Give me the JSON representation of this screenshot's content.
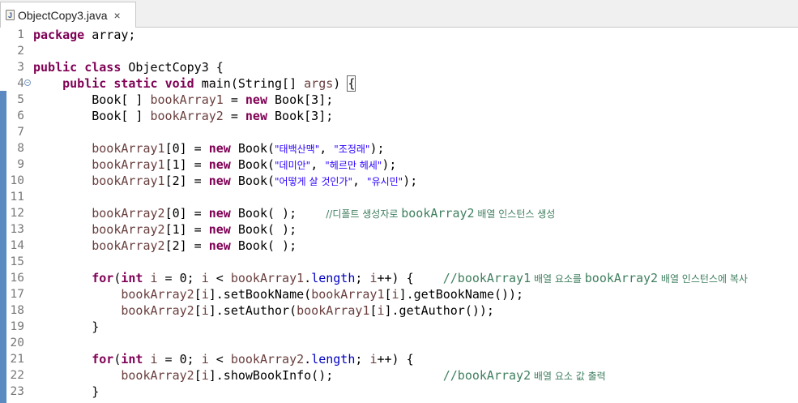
{
  "tab": {
    "title": "ObjectCopy3.java",
    "icon": "J",
    "close": "×"
  },
  "lines": [
    {
      "n": "1",
      "code": [
        {
          "t": "package",
          "c": "kw"
        },
        {
          "t": " array;"
        }
      ]
    },
    {
      "n": "2",
      "code": []
    },
    {
      "n": "3",
      "code": [
        {
          "t": "public",
          "c": "kw"
        },
        {
          "t": " "
        },
        {
          "t": "class",
          "c": "kw"
        },
        {
          "t": " ObjectCopy3 {"
        }
      ]
    },
    {
      "n": "4",
      "fold": true,
      "code": [
        {
          "t": "    "
        },
        {
          "t": "public",
          "c": "kw"
        },
        {
          "t": " "
        },
        {
          "t": "static",
          "c": "kw"
        },
        {
          "t": " "
        },
        {
          "t": "void",
          "c": "kw"
        },
        {
          "t": " main(String[] "
        },
        {
          "t": "args",
          "c": "var"
        },
        {
          "t": ") "
        },
        {
          "t": "{",
          "c": "brk"
        }
      ]
    },
    {
      "n": "5",
      "code": [
        {
          "t": "        Book[ ] "
        },
        {
          "t": "bookArray1",
          "c": "var"
        },
        {
          "t": " = "
        },
        {
          "t": "new",
          "c": "kw"
        },
        {
          "t": " Book[3];"
        }
      ]
    },
    {
      "n": "6",
      "code": [
        {
          "t": "        Book[ ] "
        },
        {
          "t": "bookArray2",
          "c": "var"
        },
        {
          "t": " = "
        },
        {
          "t": "new",
          "c": "kw"
        },
        {
          "t": " Book[3];"
        }
      ]
    },
    {
      "n": "7",
      "code": []
    },
    {
      "n": "8",
      "code": [
        {
          "t": "        "
        },
        {
          "t": "bookArray1",
          "c": "var"
        },
        {
          "t": "[0] = "
        },
        {
          "t": "new",
          "c": "kw"
        },
        {
          "t": " Book("
        },
        {
          "t": "\"태백산맥\"",
          "c": "str ko"
        },
        {
          "t": ", "
        },
        {
          "t": "\"조정래\"",
          "c": "str ko"
        },
        {
          "t": ");"
        }
      ]
    },
    {
      "n": "9",
      "code": [
        {
          "t": "        "
        },
        {
          "t": "bookArray1",
          "c": "var"
        },
        {
          "t": "[1] = "
        },
        {
          "t": "new",
          "c": "kw"
        },
        {
          "t": " Book("
        },
        {
          "t": "\"데미안\"",
          "c": "str ko"
        },
        {
          "t": ", "
        },
        {
          "t": "\"헤르만 헤세\"",
          "c": "str ko"
        },
        {
          "t": ");"
        }
      ]
    },
    {
      "n": "10",
      "code": [
        {
          "t": "        "
        },
        {
          "t": "bookArray1",
          "c": "var"
        },
        {
          "t": "[2] = "
        },
        {
          "t": "new",
          "c": "kw"
        },
        {
          "t": " Book("
        },
        {
          "t": "\"어떻게 살 것인가\"",
          "c": "str ko"
        },
        {
          "t": ", "
        },
        {
          "t": "\"유시민\"",
          "c": "str ko"
        },
        {
          "t": ");"
        }
      ]
    },
    {
      "n": "11",
      "code": []
    },
    {
      "n": "12",
      "code": [
        {
          "t": "        "
        },
        {
          "t": "bookArray2",
          "c": "var"
        },
        {
          "t": "[0] = "
        },
        {
          "t": "new",
          "c": "kw"
        },
        {
          "t": " Book( );    "
        },
        {
          "t": "//디폴트 생성자로 ",
          "c": "cmt ko"
        },
        {
          "t": "bookArray2",
          "c": "cmt"
        },
        {
          "t": " 배열 인스턴스 생성",
          "c": "cmt ko"
        }
      ]
    },
    {
      "n": "13",
      "code": [
        {
          "t": "        "
        },
        {
          "t": "bookArray2",
          "c": "var"
        },
        {
          "t": "[1] = "
        },
        {
          "t": "new",
          "c": "kw"
        },
        {
          "t": " Book( );"
        }
      ]
    },
    {
      "n": "14",
      "code": [
        {
          "t": "        "
        },
        {
          "t": "bookArray2",
          "c": "var"
        },
        {
          "t": "[2] = "
        },
        {
          "t": "new",
          "c": "kw"
        },
        {
          "t": " Book( );"
        }
      ]
    },
    {
      "n": "15",
      "code": []
    },
    {
      "n": "16",
      "code": [
        {
          "t": "        "
        },
        {
          "t": "for",
          "c": "kw"
        },
        {
          "t": "("
        },
        {
          "t": "int",
          "c": "kw"
        },
        {
          "t": " "
        },
        {
          "t": "i",
          "c": "var"
        },
        {
          "t": " = 0; "
        },
        {
          "t": "i",
          "c": "var"
        },
        {
          "t": " < "
        },
        {
          "t": "bookArray1",
          "c": "var"
        },
        {
          "t": "."
        },
        {
          "t": "length",
          "c": "fld"
        },
        {
          "t": "; "
        },
        {
          "t": "i",
          "c": "var"
        },
        {
          "t": "++) {    "
        },
        {
          "t": "//bookArray1",
          "c": "cmt"
        },
        {
          "t": " 배열 요소를 ",
          "c": "cmt ko"
        },
        {
          "t": "bookArray2",
          "c": "cmt"
        },
        {
          "t": " 배열 인스턴스에 복사",
          "c": "cmt ko"
        }
      ]
    },
    {
      "n": "17",
      "code": [
        {
          "t": "            "
        },
        {
          "t": "bookArray2",
          "c": "var"
        },
        {
          "t": "["
        },
        {
          "t": "i",
          "c": "var"
        },
        {
          "t": "].setBookName("
        },
        {
          "t": "bookArray1",
          "c": "var"
        },
        {
          "t": "["
        },
        {
          "t": "i",
          "c": "var"
        },
        {
          "t": "].getBookName());"
        }
      ]
    },
    {
      "n": "18",
      "code": [
        {
          "t": "            "
        },
        {
          "t": "bookArray2",
          "c": "var"
        },
        {
          "t": "["
        },
        {
          "t": "i",
          "c": "var"
        },
        {
          "t": "].setAuthor("
        },
        {
          "t": "bookArray1",
          "c": "var"
        },
        {
          "t": "["
        },
        {
          "t": "i",
          "c": "var"
        },
        {
          "t": "].getAuthor());"
        }
      ]
    },
    {
      "n": "19",
      "code": [
        {
          "t": "        }"
        }
      ]
    },
    {
      "n": "20",
      "code": []
    },
    {
      "n": "21",
      "code": [
        {
          "t": "        "
        },
        {
          "t": "for",
          "c": "kw"
        },
        {
          "t": "("
        },
        {
          "t": "int",
          "c": "kw"
        },
        {
          "t": " "
        },
        {
          "t": "i",
          "c": "var"
        },
        {
          "t": " = 0; "
        },
        {
          "t": "i",
          "c": "var"
        },
        {
          "t": " < "
        },
        {
          "t": "bookArray2",
          "c": "var"
        },
        {
          "t": "."
        },
        {
          "t": "length",
          "c": "fld"
        },
        {
          "t": "; "
        },
        {
          "t": "i",
          "c": "var"
        },
        {
          "t": "++) {"
        }
      ]
    },
    {
      "n": "22",
      "code": [
        {
          "t": "            "
        },
        {
          "t": "bookArray2",
          "c": "var"
        },
        {
          "t": "["
        },
        {
          "t": "i",
          "c": "var"
        },
        {
          "t": "].showBookInfo();               "
        },
        {
          "t": "//bookArray2",
          "c": "cmt"
        },
        {
          "t": " 배열 요소 값 출력",
          "c": "cmt ko"
        }
      ]
    },
    {
      "n": "23",
      "code": [
        {
          "t": "        }"
        }
      ]
    }
  ]
}
